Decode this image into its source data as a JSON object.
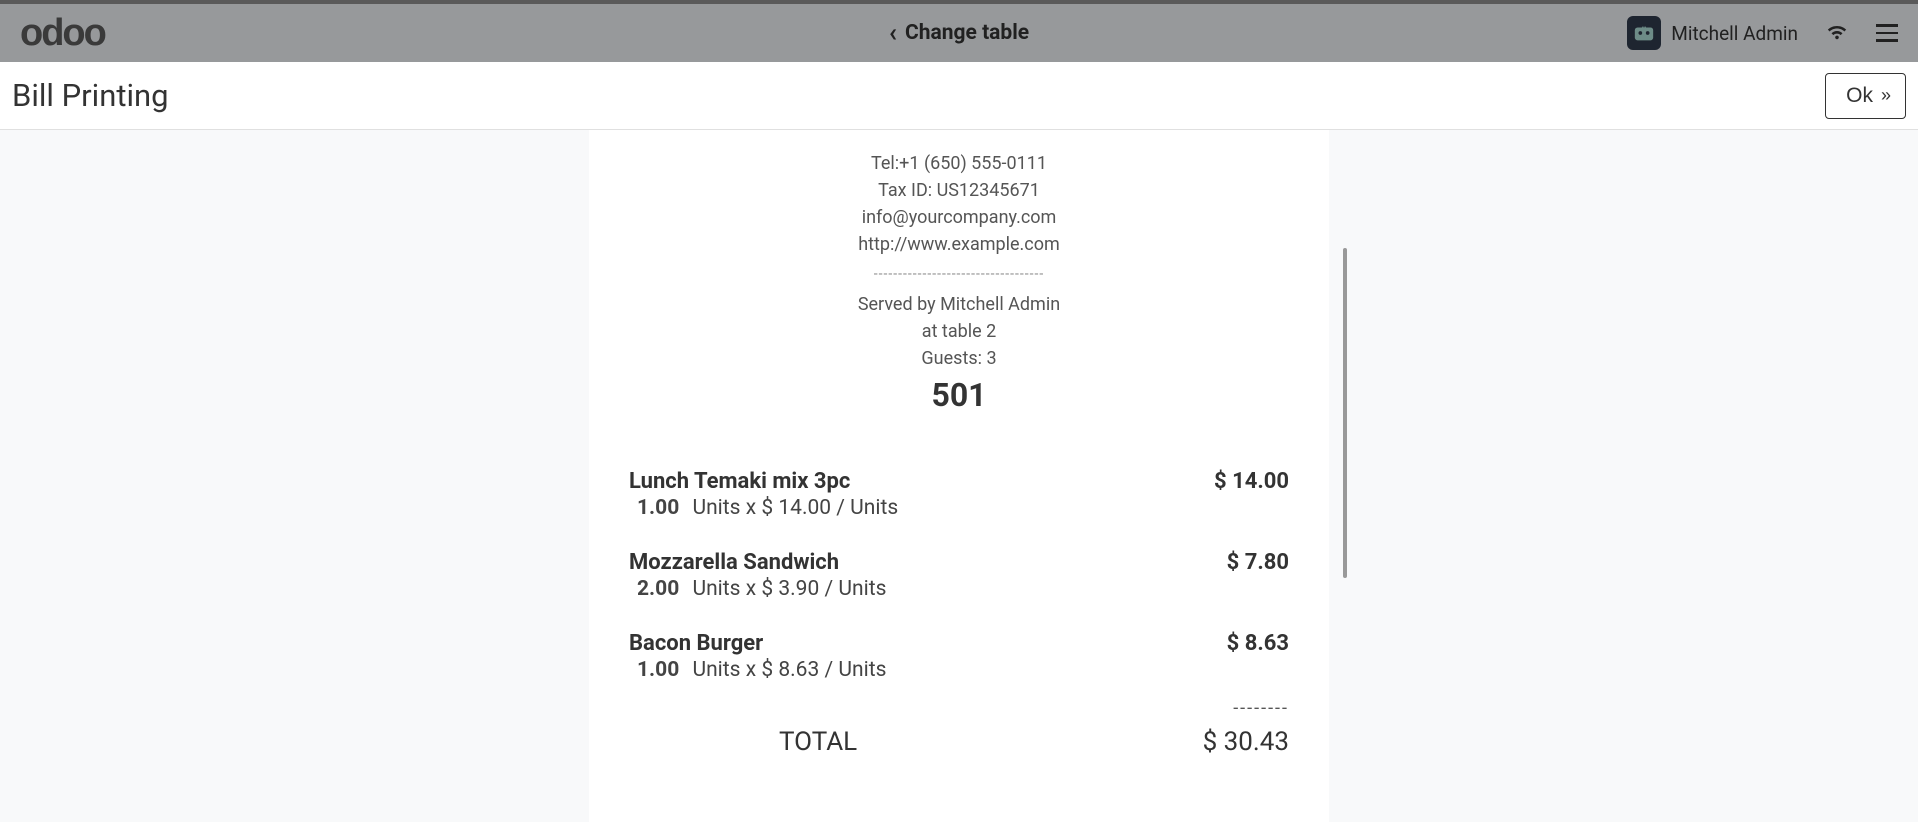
{
  "header": {
    "logo_text": "odoo",
    "center_action": "Change table",
    "username": "Mitchell Admin"
  },
  "subheader": {
    "title": "Bill Printing",
    "ok_label": "Ok"
  },
  "receipt": {
    "tel": "Tel:+1 (650) 555-0111",
    "tax_id": "Tax ID: US12345671",
    "email": "info@yourcompany.com",
    "website": "http://www.example.com",
    "served_by": "Served by Mitchell Admin",
    "at_table": "at table 2",
    "guests": "Guests: 3",
    "order_number": "501",
    "items": [
      {
        "name": "Lunch Temaki mix 3pc",
        "qty": "1.00",
        "unit_text": "Units x $ 14.00 / Units",
        "price": "$ 14.00"
      },
      {
        "name": "Mozzarella Sandwich",
        "qty": "2.00",
        "unit_text": "Units x $ 3.90 / Units",
        "price": "$ 7.80"
      },
      {
        "name": "Bacon Burger",
        "qty": "1.00",
        "unit_text": "Units x $ 8.63 / Units",
        "price": "$ 8.63"
      }
    ],
    "total_label": "TOTAL",
    "total_amount": "$ 30.43"
  }
}
